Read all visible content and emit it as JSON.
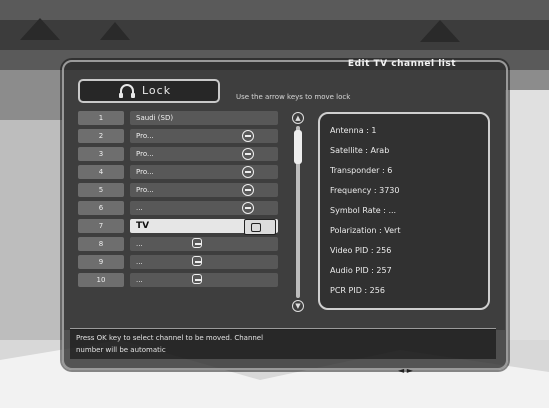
{
  "window": {
    "title": "Edit TV channel list"
  },
  "toolbar": {
    "lock_label": "Lock",
    "lock_icon": "headphones-lock-icon",
    "hint": "Use the arrow keys to move lock"
  },
  "channels": [
    {
      "num": "1",
      "name": "Saudi (SD)",
      "icon": ""
    },
    {
      "num": "2",
      "name": "Pro...",
      "icon": "scrambled-icon"
    },
    {
      "num": "3",
      "name": "Pro...",
      "icon": "scrambled-icon"
    },
    {
      "num": "4",
      "name": "Pro...",
      "icon": "scrambled-icon"
    },
    {
      "num": "5",
      "name": "Pro...",
      "icon": "scrambled-icon"
    },
    {
      "num": "6",
      "name": "...",
      "icon": "scrambled-icon"
    },
    {
      "num": "7",
      "name": "TV",
      "icon": "lock-icon",
      "selected": true
    },
    {
      "num": "8",
      "name": "...",
      "icon": "tv-icon"
    },
    {
      "num": "9",
      "name": "...",
      "icon": "tv-icon"
    },
    {
      "num": "10",
      "name": "...",
      "icon": "tv-icon"
    }
  ],
  "info": {
    "antenna": "Antenna : 1",
    "satellite": "Satellite : Arab",
    "transponder": "Transponder : 6",
    "frequency": "Frequency : 3730",
    "symbol_rate": "Symbol Rate : ...",
    "polarization": "Polarization : Vert",
    "video_pid": "Video PID : 256",
    "audio_pid": "Audio PID : 257",
    "pcr_pid": "PCR PID : 256"
  },
  "footer": {
    "line1": "Press OK key to select channel to be moved. Channel",
    "line2": "number will be automatic"
  },
  "nav": {
    "arrows": "◄ ►"
  },
  "colors": {
    "panel": "#282828",
    "selected_row": "#e6e6e6",
    "text": "#f0f0f0"
  }
}
